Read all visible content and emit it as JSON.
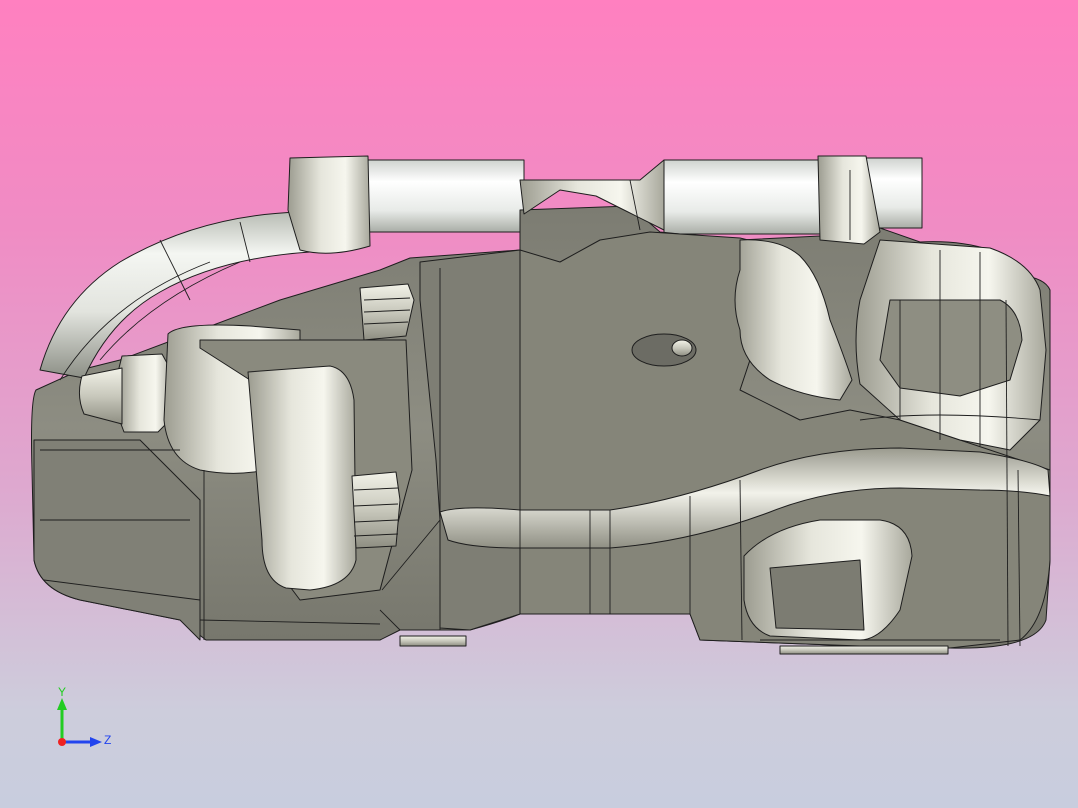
{
  "viewport": {
    "background_top": "#ff80c0",
    "background_bottom": "#c8cdde"
  },
  "model": {
    "description_icon": "brake-caliper-model",
    "body_color": "#8a8a80",
    "edge_color": "#1e1e1e"
  },
  "triad": {
    "y_label": "Y",
    "z_label": "Z",
    "y_color": "#22cc22",
    "z_color": "#2244ee",
    "x_color": "#ee2222"
  }
}
